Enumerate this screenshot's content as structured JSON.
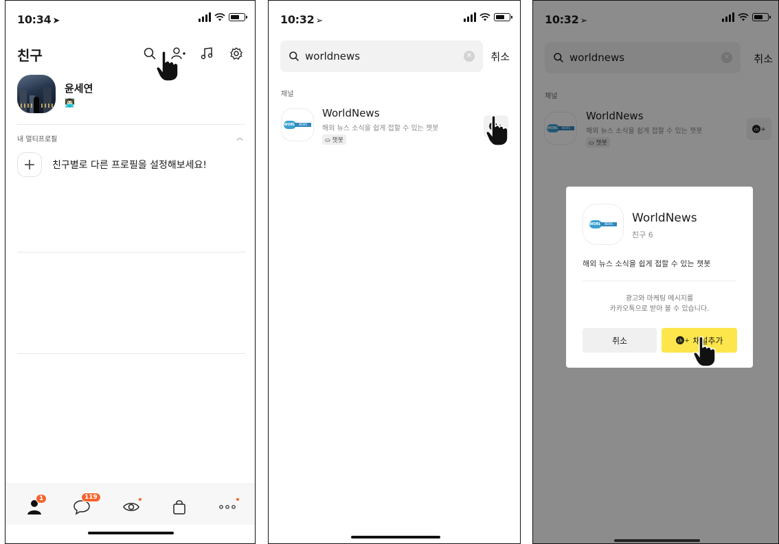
{
  "panel1": {
    "status_time": "10:34",
    "title": "친구",
    "profile_name": "윤세연",
    "profile_emoji": "👨🏻‍💻",
    "multi_profile_label": "내 멀티프로필",
    "multi_profile_prompt": "친구별로 다른 프로필을 설정해보세요!",
    "tabs": {
      "friends_badge": "1",
      "chats_badge": "119"
    }
  },
  "panel2": {
    "status_time": "10:32",
    "search_value": "worldnews",
    "cancel_label": "취소",
    "section_label": "채널",
    "channel": {
      "name": "WorldNews",
      "description": "해외 뉴스 소식을 쉽게 접할 수 있는 챗봇",
      "tag": "챗봇"
    }
  },
  "panel3": {
    "status_time": "10:32",
    "search_value": "worldnews",
    "cancel_label": "취소",
    "section_label": "채널",
    "channel": {
      "name": "WorldNews",
      "description": "해외 뉴스 소식을 쉽게 접할 수 있는 챗봇",
      "tag": "챗봇"
    },
    "modal": {
      "name": "WorldNews",
      "friends": "친구 6",
      "description": "해외 뉴스 소식을 쉽게 접할 수 있는 챗봇",
      "note_line1": "광고와 마케팅 메시지를",
      "note_line2": "카카오톡으로 받아 볼 수 있습니다.",
      "cancel_label": "취소",
      "add_label": "채널추가"
    }
  },
  "logo": {
    "left": "WORLD",
    "right": "NEWS"
  },
  "colors": {
    "accent_yellow": "#fde64b",
    "badge_orange": "#f5642d"
  }
}
